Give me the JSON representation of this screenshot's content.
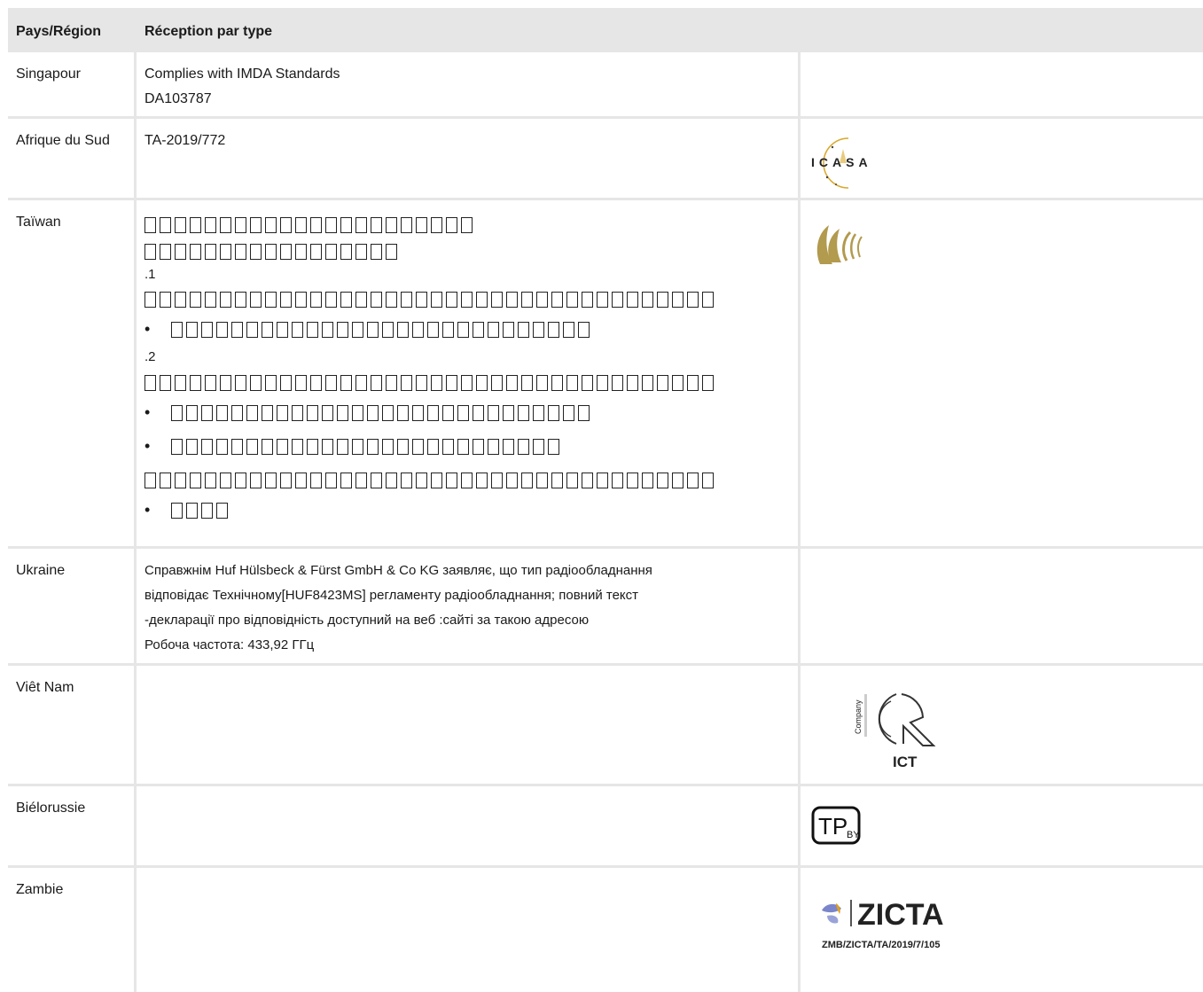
{
  "header": {
    "col1": "Pays/Région",
    "col2": "Réception par type"
  },
  "rows": {
    "singapore": {
      "country": "Singapour",
      "line1": "Complies with IMDA Standards",
      "line2": "DA103787"
    },
    "south_africa": {
      "country": "Afrique du Sud",
      "line1": "TA-2019/772",
      "logo_text": "ICASA"
    },
    "taiwan": {
      "country": "Taïwan",
      "num1": ".1",
      "num2": ".2"
    },
    "ukraine": {
      "country": "Ukraine",
      "line1": "Справжнім Huf Hülsbeck & Fürst GmbH & Co KG заявляє, що тип радіообладнання",
      "line2": "відповідає Технічному[HUF8423MS] регламенту радіообладнання; повний текст",
      "line3": "-декларації про відповідність доступний на веб :сайті за такою адресою",
      "line4": "Робоча частота: 433,92 ГГц"
    },
    "vietnam": {
      "country": "Viêt Nam",
      "logo_company": "Company",
      "logo_ict": "ICT"
    },
    "belarus": {
      "country": "Biélorussie",
      "logo_text": "TP",
      "logo_sub": "BY"
    },
    "zambia": {
      "country": "Zambie",
      "logo_text": "ZICTA",
      "logo_code": "ZMB/ZICTA/TA/2019/7/105"
    }
  }
}
